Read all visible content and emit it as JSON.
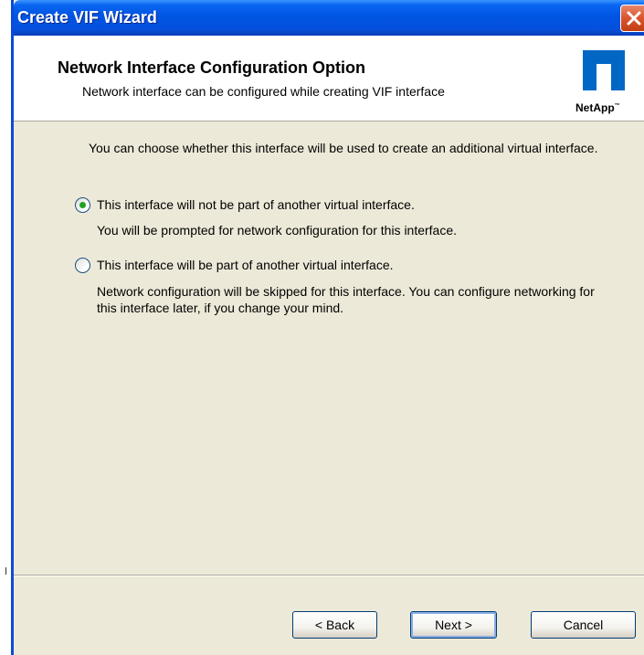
{
  "window": {
    "title": "Create VIF Wizard"
  },
  "header": {
    "title": "Network Interface Configuration Option",
    "subtitle": "Network interface can be configured while creating VIF interface",
    "logo_text": "NetApp",
    "logo_mark": "™"
  },
  "content": {
    "intro": "You can choose whether this interface will be used to create an additional virtual interface.",
    "options": [
      {
        "label": "This interface will not be part of another virtual interface.",
        "description": "You will be prompted for network configuration for this interface.",
        "checked": true
      },
      {
        "label": "This interface will be part of another virtual interface.",
        "description": "Network configuration will be skipped for this interface. You can configure networking for this interface later, if you change your mind.",
        "checked": false
      }
    ]
  },
  "buttons": {
    "back": "< Back",
    "next": "Next >",
    "cancel": "Cancel"
  },
  "colors": {
    "titlebar": "#0054e3",
    "dialog_bg": "#ece9d8",
    "close_button": "#d8542d",
    "radio_dot": "#21a121",
    "logo": "#0067c5"
  },
  "icons": {
    "close": "close-icon",
    "logo": "netapp-logo-icon"
  }
}
